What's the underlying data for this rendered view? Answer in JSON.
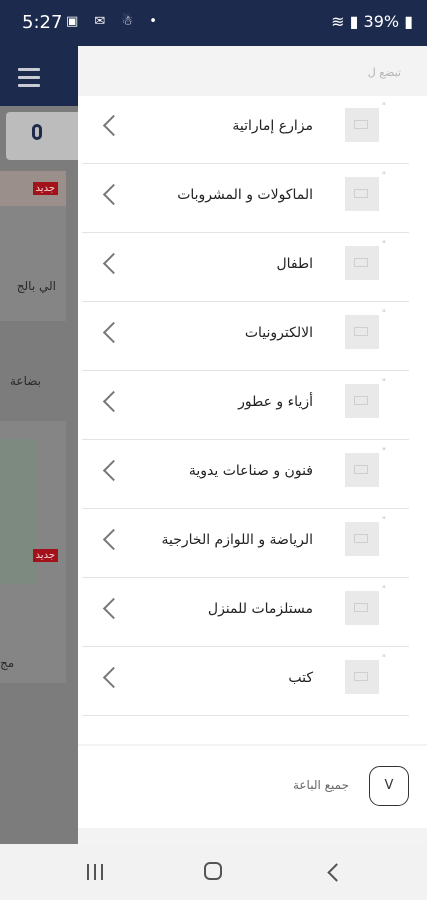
{
  "status_bar": {
    "time": "5:27",
    "notification_icons": [
      "image-icon",
      "mail-icon",
      "ghost-icon",
      "dot"
    ],
    "battery_text": "39%"
  },
  "background_app": {
    "badge_new": "جديد",
    "badge_new_2": "جديد",
    "text_1": "الي بالج",
    "text_2": "بضاعة",
    "text_3": "مج"
  },
  "drawer": {
    "hint": "تبضع ل",
    "categories": [
      {
        "label": "مزارع إماراتية",
        "icon": "image-placeholder-icon"
      },
      {
        "label": "الماكولات و المشروبات",
        "icon": "image-placeholder-icon"
      },
      {
        "label": "اطفال",
        "icon": "image-placeholder-icon"
      },
      {
        "label": "الالكترونيات",
        "icon": "image-placeholder-icon"
      },
      {
        "label": "أزياء و عطور",
        "icon": "image-placeholder-icon"
      },
      {
        "label": "فنون و صناعات يدوية",
        "icon": "image-placeholder-icon"
      },
      {
        "label": "الرياضة و اللوازم الخارجية",
        "icon": "image-placeholder-icon"
      },
      {
        "label": "مستلزمات للمنزل",
        "icon": "image-placeholder-icon"
      },
      {
        "label": "كتب",
        "icon": "image-placeholder-icon"
      }
    ],
    "footer": {
      "all_sellers": "جميع الباعة",
      "v_label": "V"
    }
  },
  "colors": {
    "header": "#1c2a4e",
    "badge": "#a3121b",
    "drawer_bg": "#ffffff"
  }
}
